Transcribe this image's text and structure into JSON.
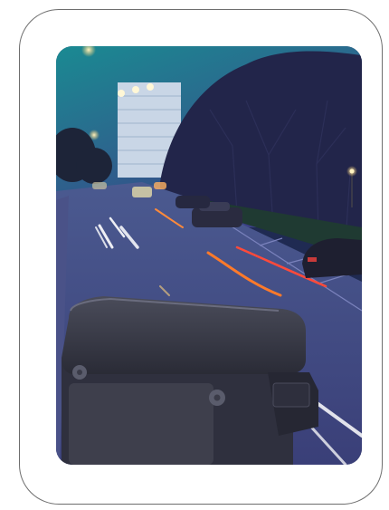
{
  "frame": {
    "border_color": "#6e6e6e",
    "background": "#ffffff"
  },
  "photo": {
    "subject": "",
    "colors": {
      "sky_top": "#1d7f8c",
      "sky_bottom": "#3b3f86",
      "road": "#4a4f8a",
      "headlight_trail": "#ffffff",
      "taillight_trail": "#ff5a2a",
      "street_light": "#ffd27a",
      "box_body": "#3a3c4a"
    }
  }
}
